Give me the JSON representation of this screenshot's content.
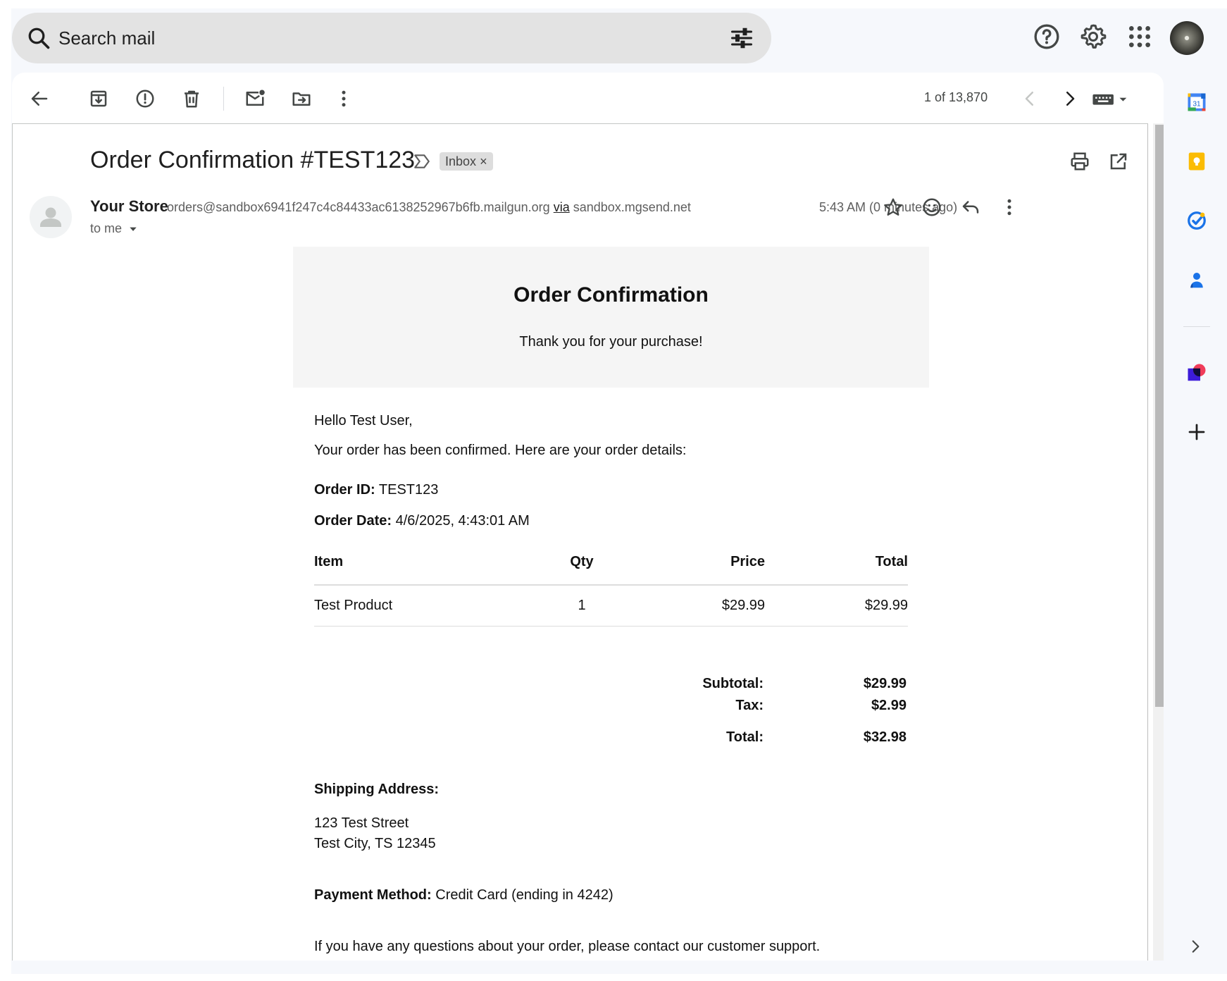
{
  "search": {
    "placeholder": "Search mail"
  },
  "toolbar": {
    "count": "1 of 13,870"
  },
  "message": {
    "subject": "Order Confirmation #TEST123",
    "label": "Inbox",
    "label_close": "×",
    "sender_name": "Your Store",
    "sender_email": "orders@sandbox6941f247c4c84433ac6138252967b6fb.mailgun.org",
    "via": "via",
    "via_domain": "sandbox.mgsend.net",
    "to": "to me",
    "time": "5:43 AM (0 minutes ago)"
  },
  "email": {
    "banner_title": "Order Confirmation",
    "banner_subtitle": "Thank you for your purchase!",
    "greeting": "Hello Test User,",
    "intro": "Your order has been confirmed. Here are your order details:",
    "order_id_label": "Order ID:",
    "order_id": "TEST123",
    "order_date_label": "Order Date:",
    "order_date": "4/6/2025, 4:43:01 AM",
    "table": {
      "headers": [
        "Item",
        "Qty",
        "Price",
        "Total"
      ],
      "rows": [
        [
          "Test Product",
          "1",
          "$29.99",
          "$29.99"
        ]
      ]
    },
    "subtotal_label": "Subtotal:",
    "subtotal": "$29.99",
    "tax_label": "Tax:",
    "tax": "$2.99",
    "total_label": "Total:",
    "total": "$32.98",
    "shipping_label": "Shipping Address:",
    "shipping_line1": "123 Test Street",
    "shipping_line2": "Test City, TS 12345",
    "payment_label": "Payment Method:",
    "payment": "Credit Card (ending in 4242)",
    "footer": "If you have any questions about your order, please contact our customer support."
  },
  "rail": {
    "calendar_day": "31"
  }
}
